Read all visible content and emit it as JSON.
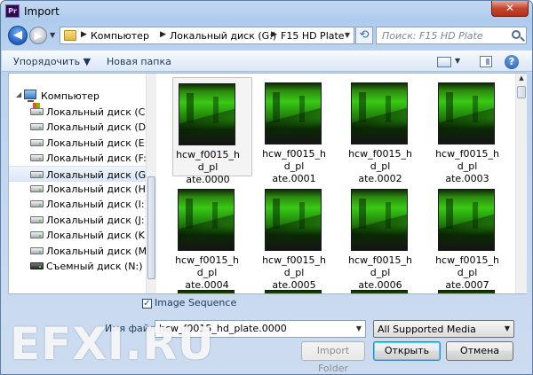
{
  "window": {
    "title": "Import",
    "app_icon": "Pr",
    "close_glyph": "✕"
  },
  "nav": {
    "back_glyph": "◀",
    "forward_glyph": "▶"
  },
  "address": {
    "crumbs": [
      "Компьютер",
      "Локальный диск (G:)",
      "F15 HD Plate"
    ]
  },
  "search": {
    "placeholder": "Поиск: F15 HD Plate"
  },
  "toolbar": {
    "organize_label": "Упорядочить ▼",
    "new_folder_label": "Новая папка",
    "help_glyph": "?"
  },
  "tree": {
    "root_label": "Компьютер",
    "items": [
      {
        "label": "Локальный диск (C:)",
        "icon": "system-drive-icon"
      },
      {
        "label": "Локальный диск (D:)",
        "icon": "drive-icon"
      },
      {
        "label": "Локальный диск (E:)",
        "icon": "drive-icon"
      },
      {
        "label": "Локальный диск (F:)",
        "icon": "drive-icon"
      },
      {
        "label": "Локальный диск (G:)",
        "icon": "drive-icon"
      },
      {
        "label": "Локальный диск (H:)",
        "icon": "drive-icon"
      },
      {
        "label": "Локальный диск (I:)",
        "icon": "drive-icon"
      },
      {
        "label": "Локальный диск (J:)",
        "icon": "drive-icon"
      },
      {
        "label": "Локальный диск (K:)",
        "icon": "drive-icon"
      },
      {
        "label": "Локальный диск (M:)",
        "icon": "drive-icon"
      },
      {
        "label": "Съемный диск (N:)",
        "icon": "removable-drive-icon"
      }
    ],
    "selected": "Локальный диск (G:)"
  },
  "files": [
    {
      "name": "hcw_f0015_hd_plate.0000",
      "line1": "hcw_f0015_hd_pl",
      "line2": "ate.0000"
    },
    {
      "name": "hcw_f0015_hd_plate.0001",
      "line1": "hcw_f0015_hd_pl",
      "line2": "ate.0001"
    },
    {
      "name": "hcw_f0015_hd_plate.0002",
      "line1": "hcw_f0015_hd_pl",
      "line2": "ate.0002"
    },
    {
      "name": "hcw_f0015_hd_plate.0003",
      "line1": "hcw_f0015_hd_pl",
      "line2": "ate.0003"
    },
    {
      "name": "hcw_f0015_hd_plate.0004",
      "line1": "hcw_f0015_hd_pl",
      "line2": "ate.0004"
    },
    {
      "name": "hcw_f0015_hd_plate.0005",
      "line1": "hcw_f0015_hd_pl",
      "line2": "ate.0005"
    },
    {
      "name": "hcw_f0015_hd_plate.0006",
      "line1": "hcw_f0015_hd_pl",
      "line2": "ate.0006"
    },
    {
      "name": "hcw_f0015_hd_plate.0007",
      "line1": "hcw_f0015_hd_pl",
      "line2": "ate.0007"
    }
  ],
  "image_sequence": {
    "label": "Image Sequence",
    "checked": true,
    "check_glyph": "✓"
  },
  "filename": {
    "label": "Имя файла:",
    "value": "hcw_f0015_hd_plate.0000"
  },
  "filter": {
    "value": "All Supported Media"
  },
  "buttons": {
    "import_folder": "Import Folder",
    "open": "Открыть",
    "cancel": "Отмена"
  },
  "watermark": "EFXI.RU"
}
